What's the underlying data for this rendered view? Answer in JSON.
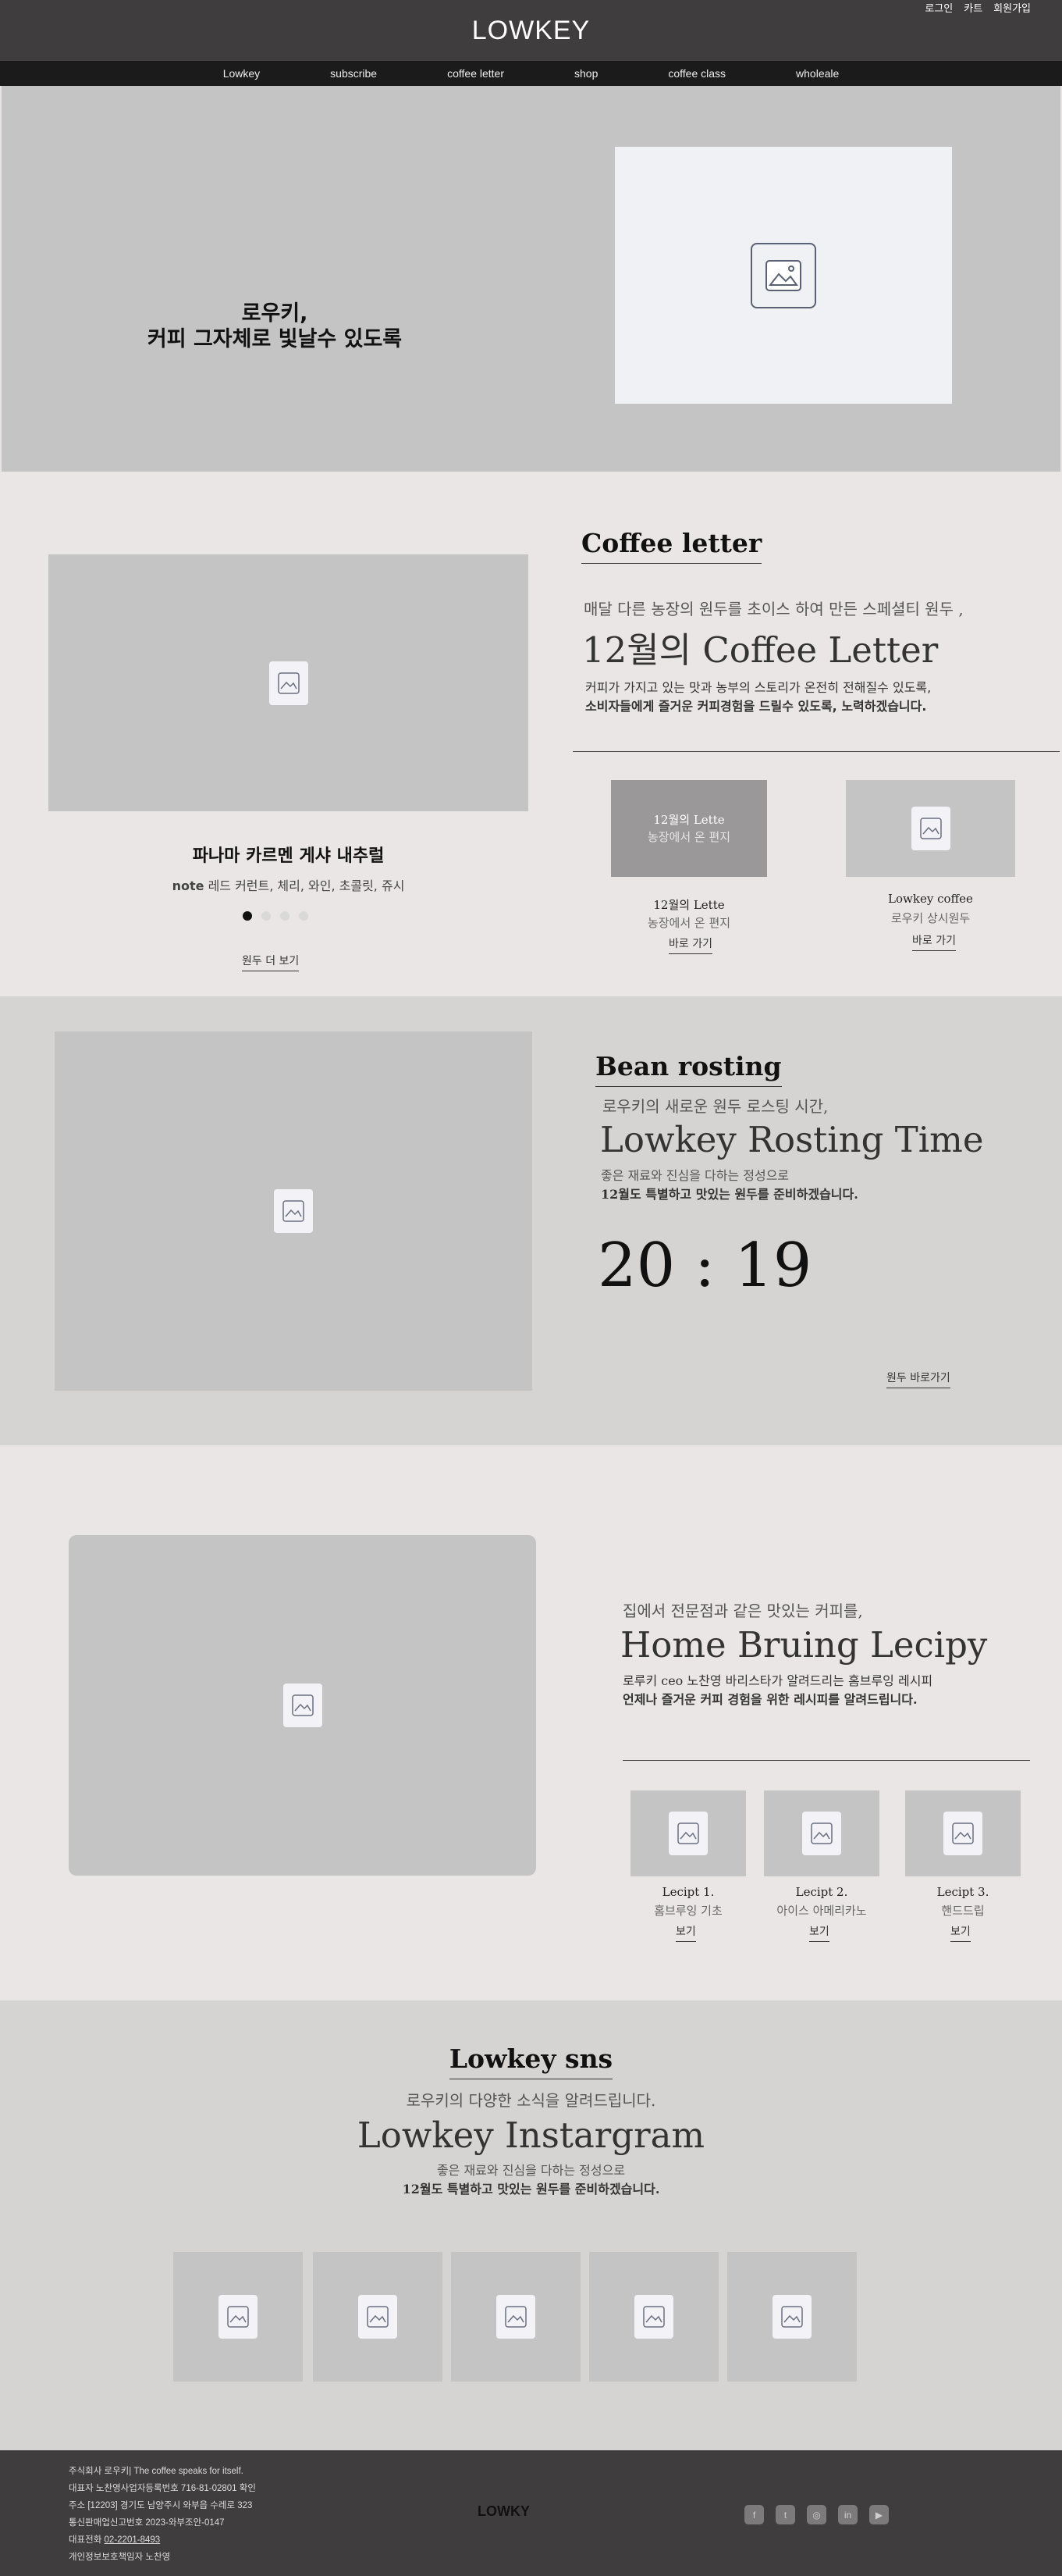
{
  "header": {
    "brand": "LOWKEY",
    "toplinks": [
      "로그인",
      "카트",
      "회원가입"
    ],
    "nav": [
      "Lowkey",
      "subscribe",
      "coffee letter",
      "shop",
      "coffee class",
      "wholeale"
    ]
  },
  "hero": {
    "line1": "로우키,",
    "line2": "커피 그자체로 빛날수 있도록"
  },
  "coffee_letter": {
    "title": "Coffee letter",
    "subtitle": "매달 다른 농장의 원두를 초이스 하여 만든 스페셜티 원두 ,",
    "heading": "12월의 Coffee Letter",
    "desc1": "커피가 가지고 있는 맛과 농부의 스토리가 온전히 전해질수 있도록,",
    "desc2": "소비자들에게 즐거운 커피경험을 드릴수 있도록, 노력하겠습니다.",
    "product_name": "파나마 카르멘 게샤 내추럴",
    "product_note_label": "note",
    "product_note": "레드 커런트, 체리, 와인, 초콜릿, 쥬시",
    "more_link": "원두 더 보기",
    "card1_overlay_title": "12월의 Lette",
    "card1_overlay_sub": "농장에서 온 편지",
    "card1_title": "12월의 Lette",
    "card1_sub": "농장에서 온 편지",
    "card1_link": "바로 가기",
    "card2_title": "Lowkey coffee",
    "card2_sub": "로우키 상시원두",
    "card2_link": "바로 가기"
  },
  "bean": {
    "title": "Bean rosting",
    "subtitle": "로우키의 새로운 원두 로스팅 시간,",
    "heading": "Lowkey Rosting Time",
    "desc1": "좋은 재료와 진심을 다하는 정성으로",
    "desc2": "12월도 특별하고 맛있는 원두를 준비하겠습니다.",
    "time": "20 : 19",
    "link": "원두 바로가기"
  },
  "home": {
    "subtitle": "집에서 전문점과 같은 맛있는 커피를,",
    "heading": "Home Bruing Lecipy",
    "desc1": "로루키 ceo 노찬영 바리스타가 알려드리는 홈브루잉 레시피",
    "desc2": "언제나 즐거운 커피 경험을 위한 레시피를 알려드립니다.",
    "recipes": [
      {
        "title": "Lecipt 1.",
        "sub": "홈브루잉 기초",
        "link": "보기"
      },
      {
        "title": "Lecipt 2.",
        "sub": "아이스 아메리카노",
        "link": "보기"
      },
      {
        "title": "Lecipt 3.",
        "sub": "핸드드립",
        "link": "보기"
      }
    ]
  },
  "sns": {
    "title": "Lowkey sns",
    "subtitle": "로우키의 다양한 소식을 알려드립니다.",
    "heading": "Lowkey Instargram",
    "desc1": "좋은 재료와 진심을 다하는 정성으로",
    "desc2": "12월도 특별하고 맛있는 원두를 준비하겠습니다."
  },
  "footer": {
    "lines": [
      "주식회사 로우키| The coffee speaks for itself.",
      "대표자 노찬영사업자등록번호 716-81-02801 확인",
      "주소 [12203] 경기도 남양주시 와부읍 수레로 323",
      "통신판매업신고번호 2023-와부조안-0147"
    ],
    "phone_label": "대표전화",
    "phone": "02-2201-8493",
    "privacy": "개인정보보호책임자 노찬영",
    "logo": "LOWKY",
    "social": [
      "f",
      "t",
      "◎",
      "in",
      "▶"
    ]
  }
}
